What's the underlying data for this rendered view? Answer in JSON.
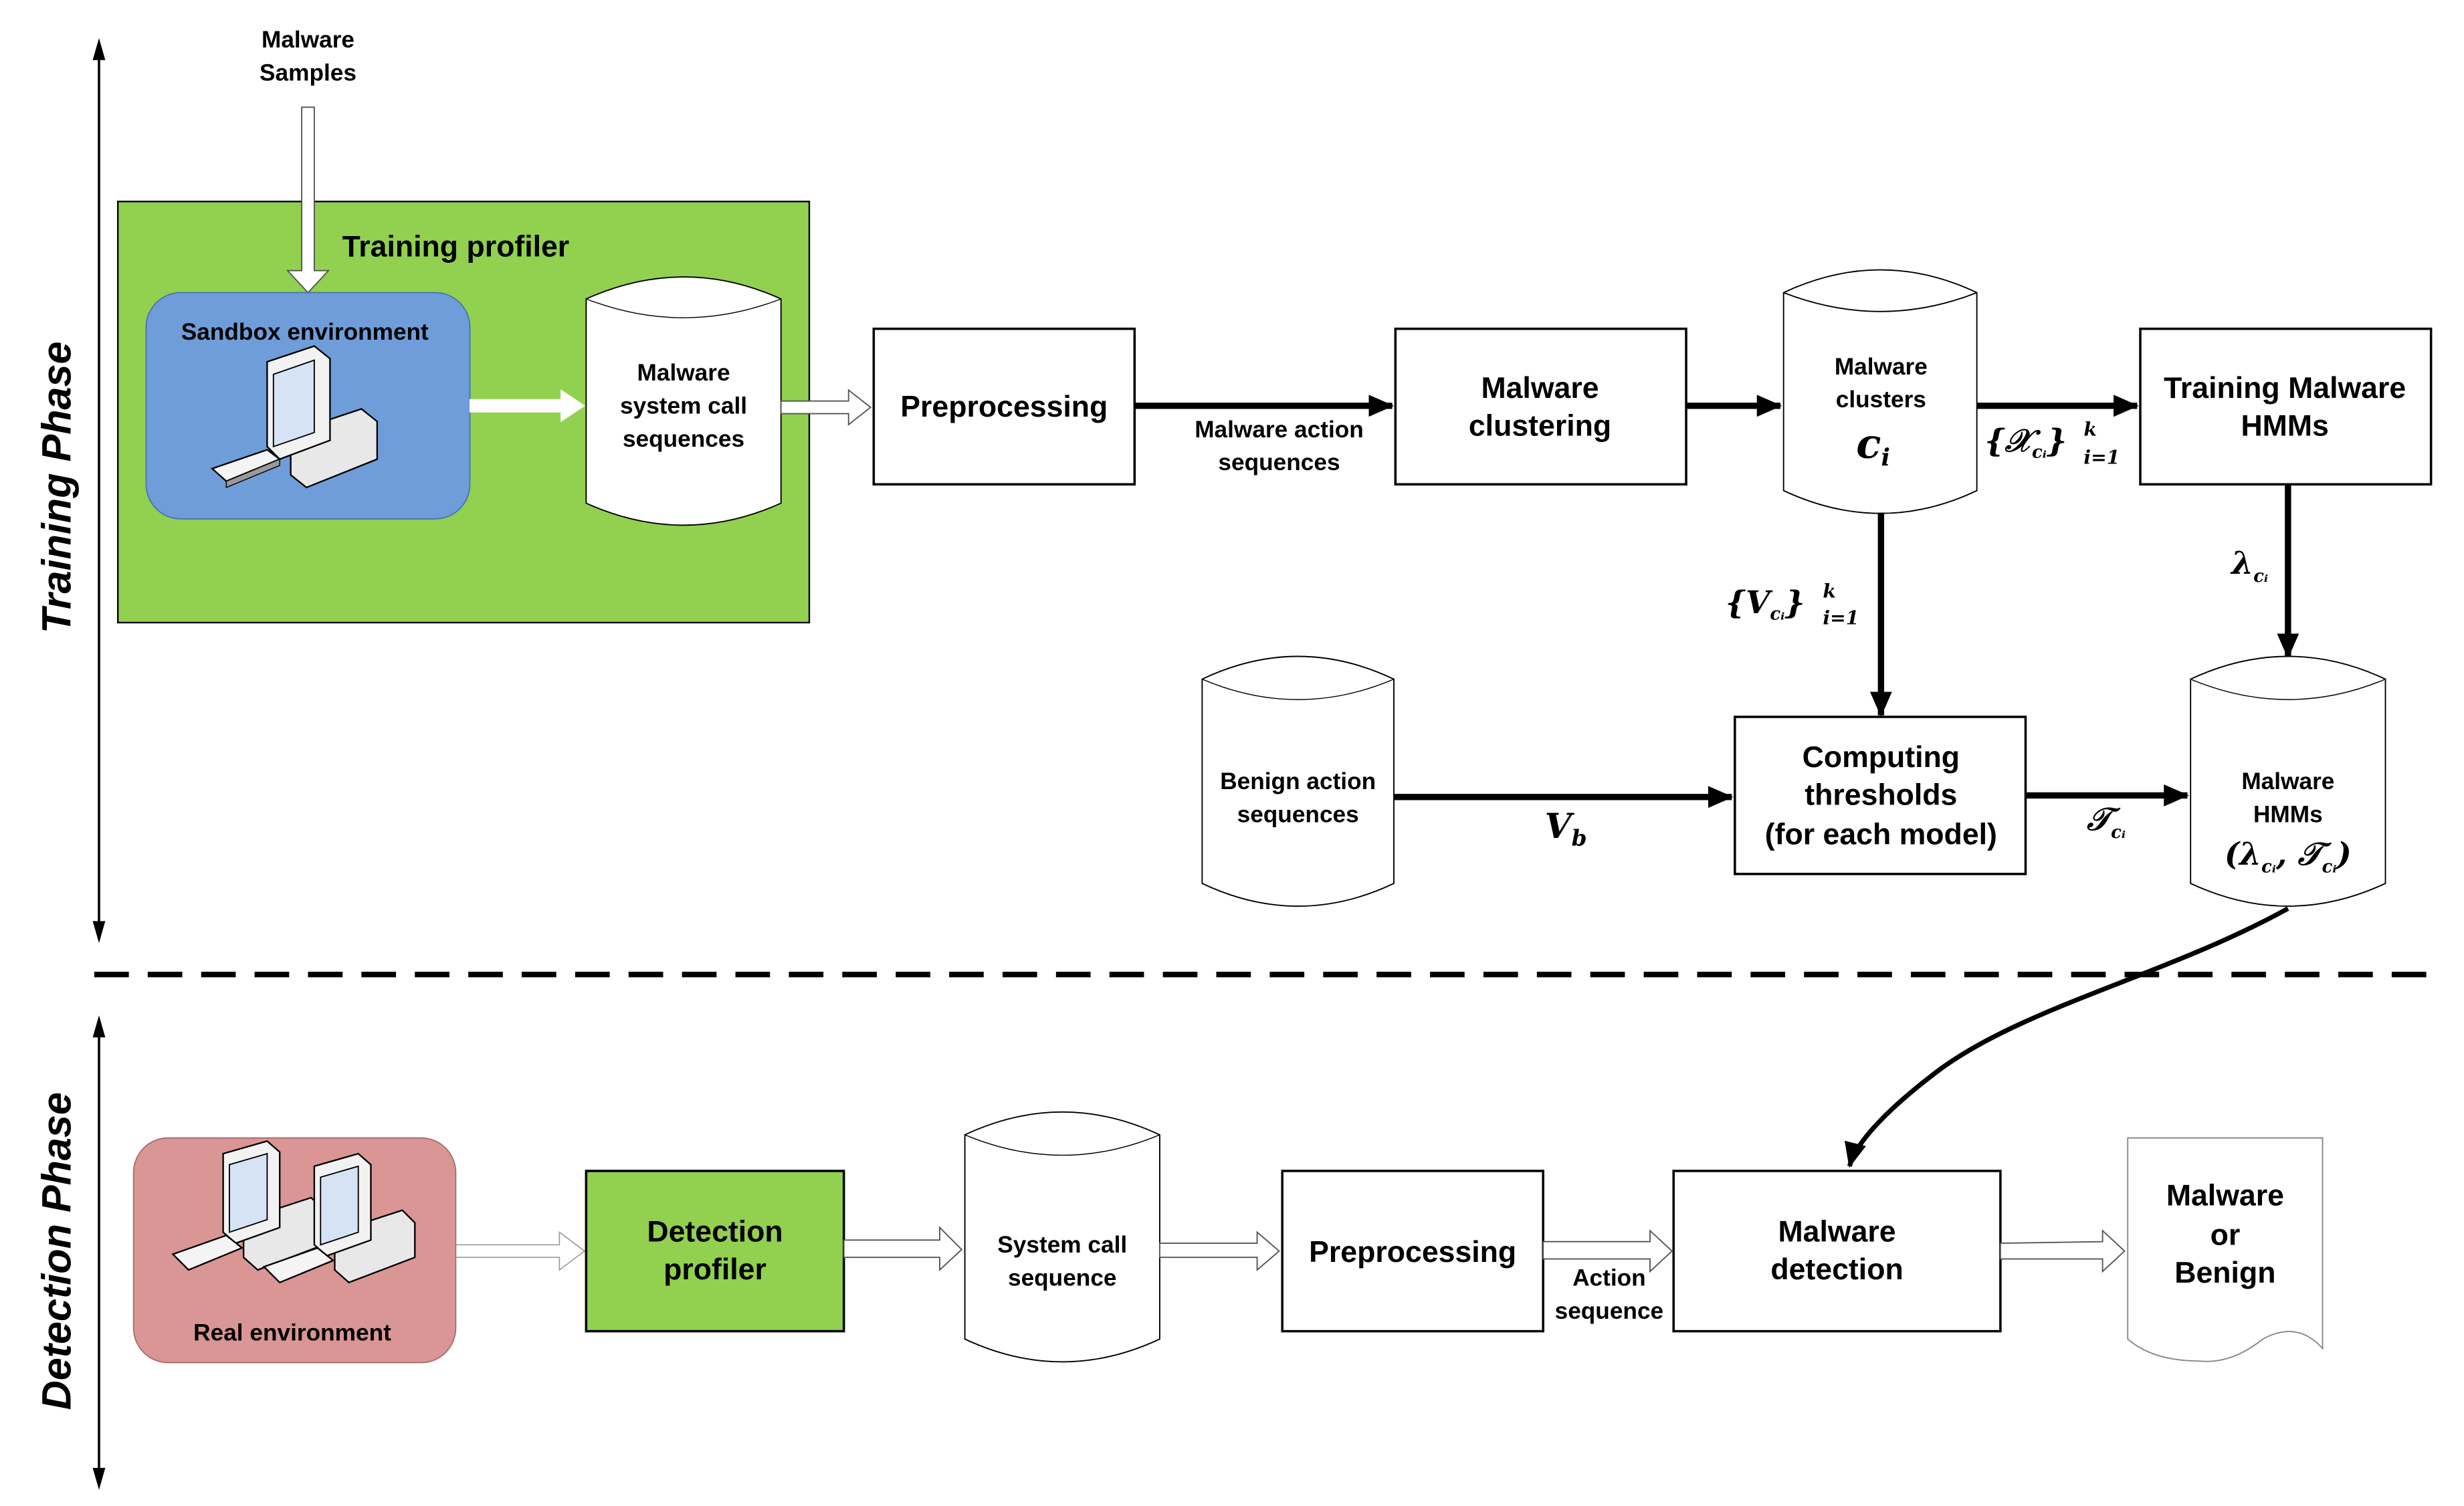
{
  "colors": {
    "training_profiler_bg": "#92d050",
    "sandbox_bg": "#6f9dd9",
    "real_env_bg": "#d99694",
    "detection_profiler_bg": "#92d050"
  },
  "phases": {
    "training": "Training Phase",
    "detection": "Detection Phase"
  },
  "training": {
    "input_label_line1": "Malware",
    "input_label_line2": "Samples",
    "profiler_title": "Training profiler",
    "sandbox_label": "Sandbox environment",
    "syscall_store": [
      "Malware",
      "system call",
      "sequences"
    ],
    "preprocessing": "Preprocessing",
    "action_seq_label": [
      "Malware action",
      "sequences"
    ],
    "clustering": [
      "Malware",
      "clustering"
    ],
    "clusters_store": [
      "Malware",
      "clusters"
    ],
    "clusters_symbol": "c",
    "clusters_symbol_sub": "i",
    "x_set_label": "{𝒳",
    "x_set_sub": "cᵢ",
    "x_set_close": "}",
    "x_set_sup": "k",
    "x_set_range": "i=1",
    "training_hmm": [
      "Training Malware",
      "HMMs"
    ],
    "lambda_label": "λ",
    "lambda_sub": "cᵢ",
    "v_set_label": "{V",
    "v_set_sub": "cᵢ",
    "v_set_close": "}",
    "v_set_sup": "k",
    "v_set_range": "i=1",
    "benign_store": [
      "Benign action",
      "sequences"
    ],
    "vb_label": "V",
    "vb_sub": "b",
    "thresholds": [
      "Computing",
      "thresholds",
      "(for each model)"
    ],
    "tau_label": "𝒯",
    "tau_sub": "cᵢ",
    "hmm_store": [
      "Malware",
      "HMMs"
    ],
    "hmm_store_tuple": "(λ",
    "hmm_store_tuple_sub1": "cᵢ",
    "hmm_store_tuple_mid": ", 𝒯",
    "hmm_store_tuple_sub2": "cᵢ",
    "hmm_store_tuple_close": ")"
  },
  "detection": {
    "real_env_label": "Real environment",
    "profiler": [
      "Detection",
      "profiler"
    ],
    "syscall_store": [
      "System call",
      "sequence"
    ],
    "preprocessing": "Preprocessing",
    "action_seq_label": [
      "Action",
      "sequence"
    ],
    "detector": [
      "Malware",
      "detection"
    ],
    "output": [
      "Malware",
      "or",
      "Benign"
    ]
  }
}
